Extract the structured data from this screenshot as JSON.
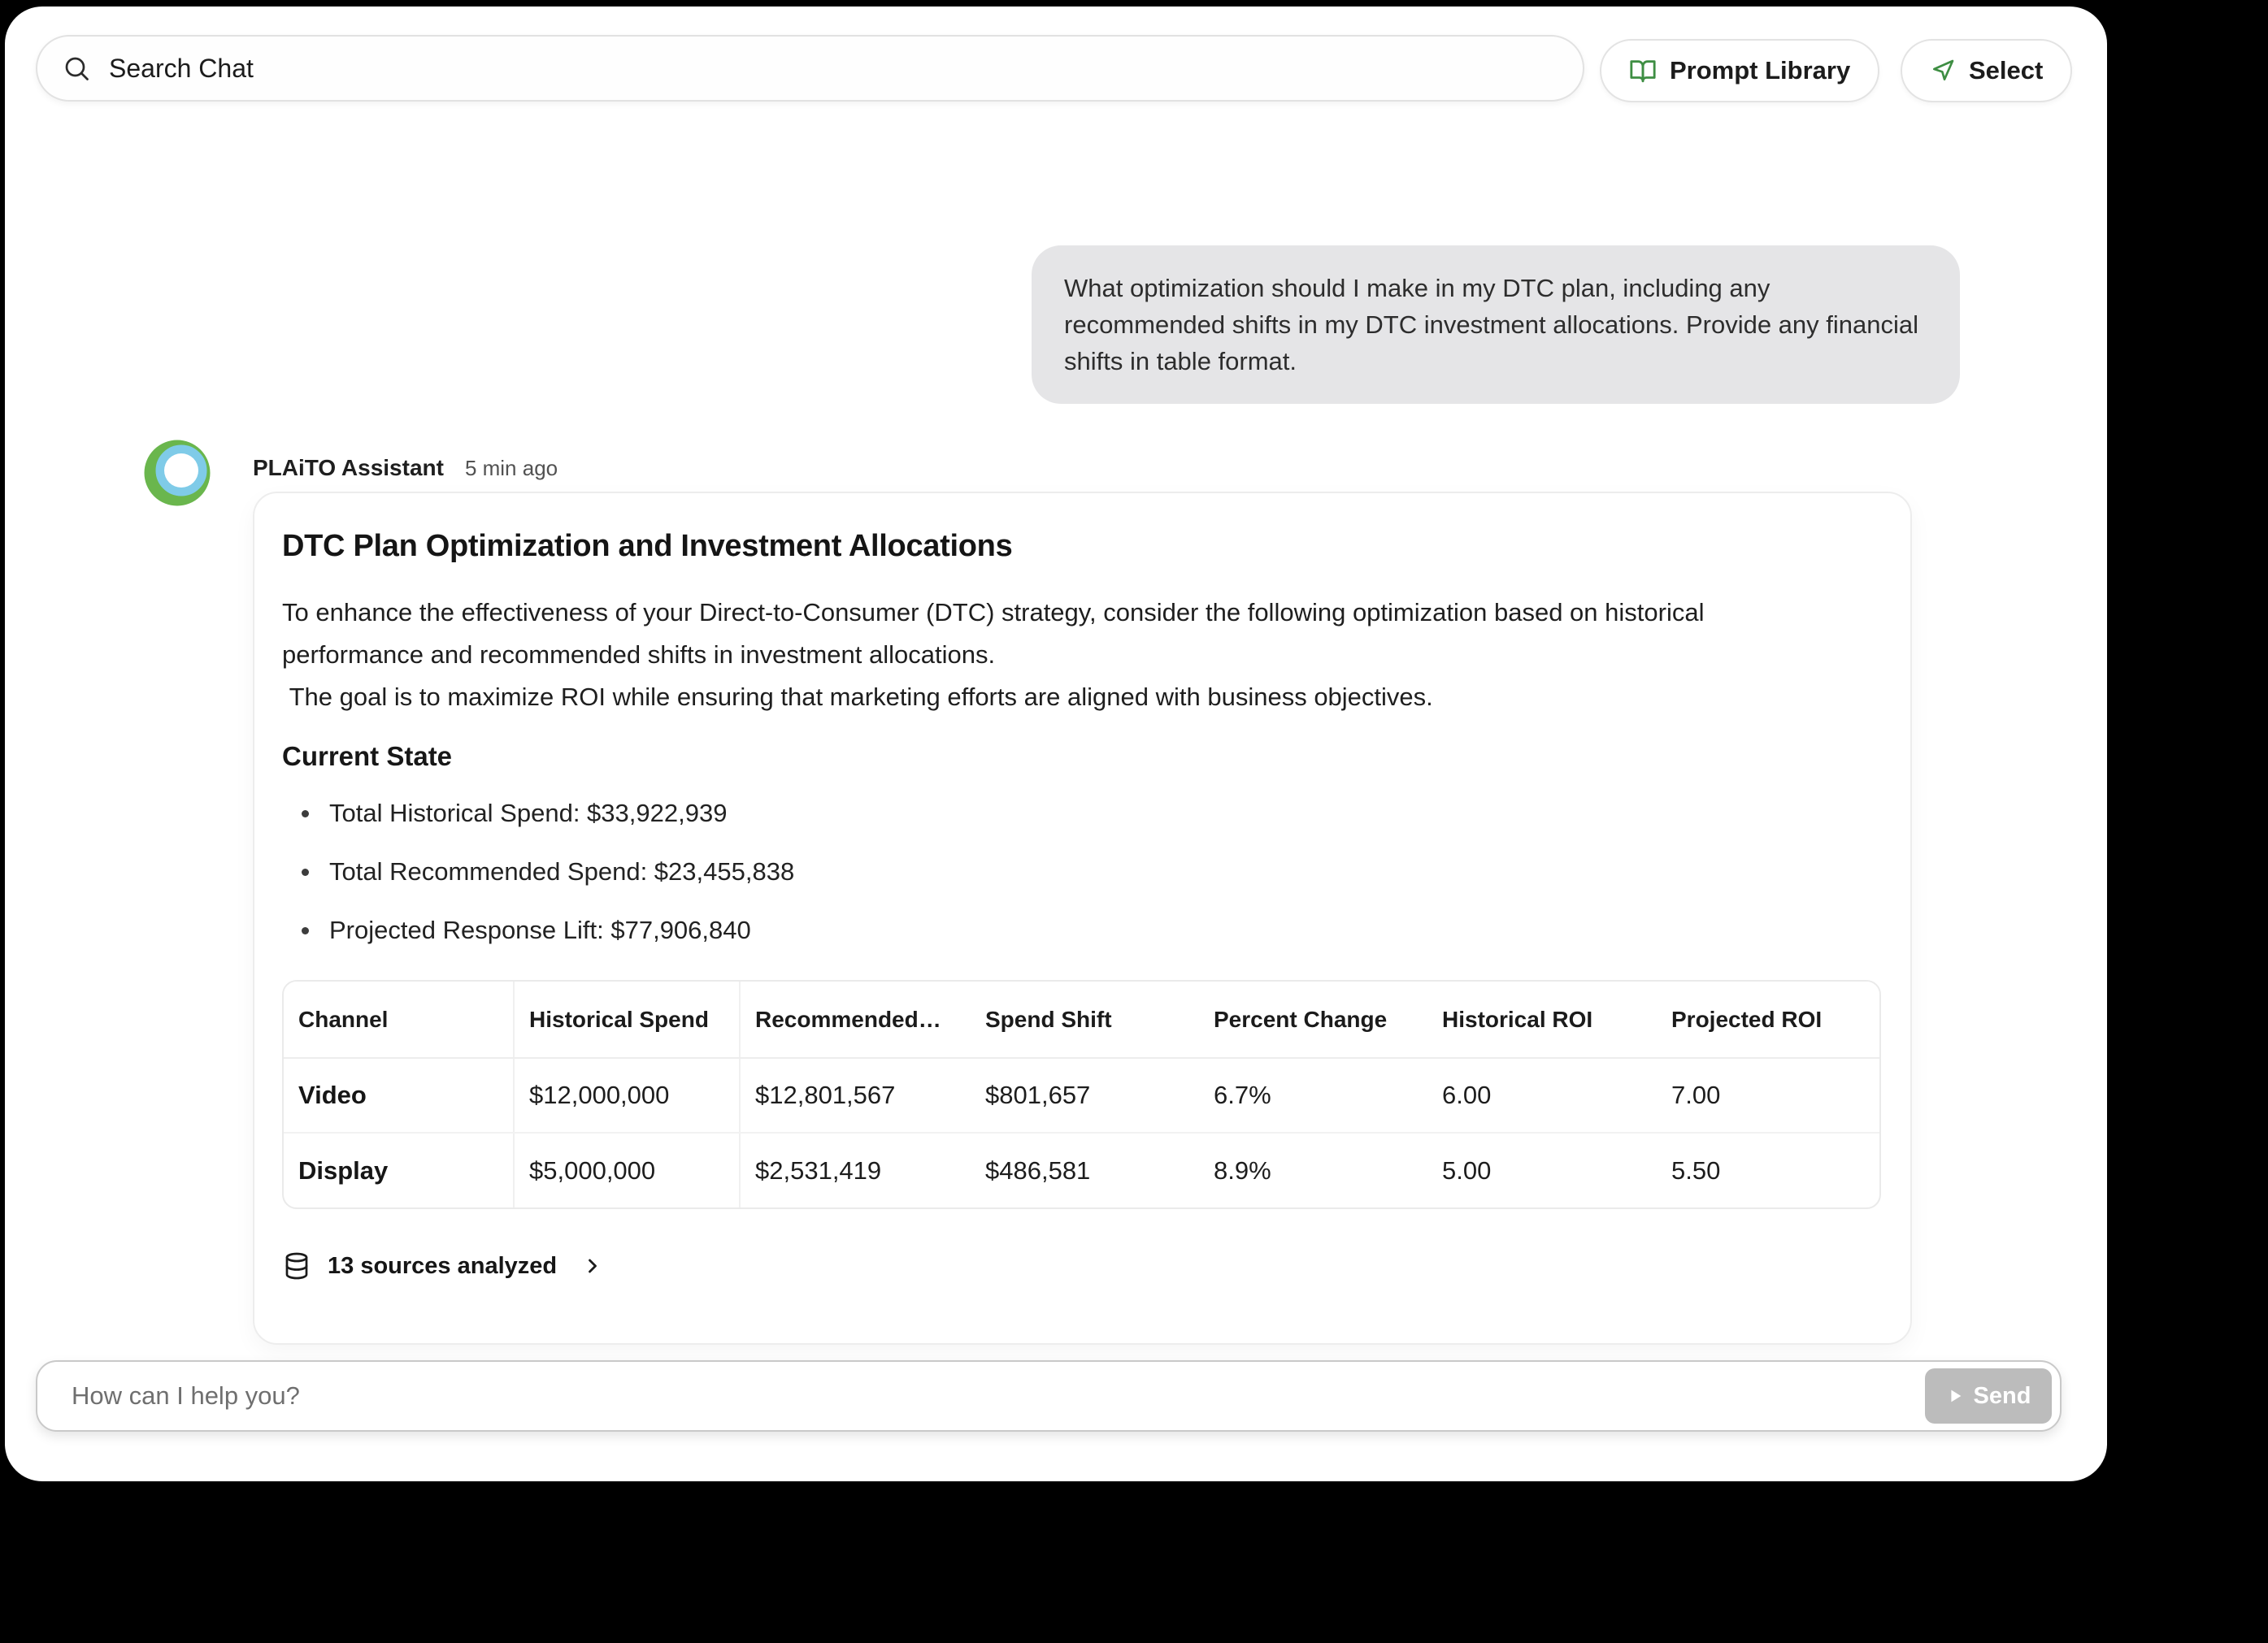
{
  "topbar": {
    "search": {
      "placeholder": "Search Chat"
    },
    "prompt_library_label": "Prompt Library",
    "select_label": "Select"
  },
  "conversation": {
    "user_message": "What optimization should I make in my DTC plan, including any recommended shifts in my DTC investment allocations. Provide any financial shifts in table format.",
    "assistant": {
      "name": "PLAiTO Assistant",
      "timestamp": "5 min ago",
      "card": {
        "title": "DTC Plan Optimization and Investment Allocations",
        "intro_line1": "To enhance the effectiveness of your Direct-to-Consumer (DTC) strategy, consider the following optimization based on historical performance and recommended shifts in investment allocations.",
        "intro_line2": " The goal is to maximize ROI while ensuring that marketing efforts are aligned with business objectives.",
        "section_heading": "Current State",
        "bullets": [
          "Total Historical Spend: $33,922,939",
          "Total Recommended Spend: $23,455,838",
          "Projected Response Lift: $77,906,840"
        ],
        "table": {
          "headers": [
            "Channel",
            "Historical Spend",
            "Recommended…",
            "Spend Shift",
            "Percent Change",
            "Historical ROI",
            "Projected ROI"
          ],
          "rows": [
            [
              "Video",
              "$12,000,000",
              "$12,801,567",
              "$801,657",
              "6.7%",
              "6.00",
              "7.00"
            ],
            [
              "Display",
              "$5,000,000",
              "$2,531,419",
              "$486,581",
              "8.9%",
              "5.00",
              "5.50"
            ]
          ]
        },
        "sources_label": "13 sources analyzed"
      }
    }
  },
  "composer": {
    "placeholder": "How can I help you?",
    "send_label": "Send"
  },
  "colors": {
    "accent_green": "#3e8e43",
    "avatar_green": "#6ab64d",
    "avatar_blue": "#7fcbe8",
    "bubble_bg": "#e5e5e7",
    "send_button_bg": "#bcbcbc"
  }
}
